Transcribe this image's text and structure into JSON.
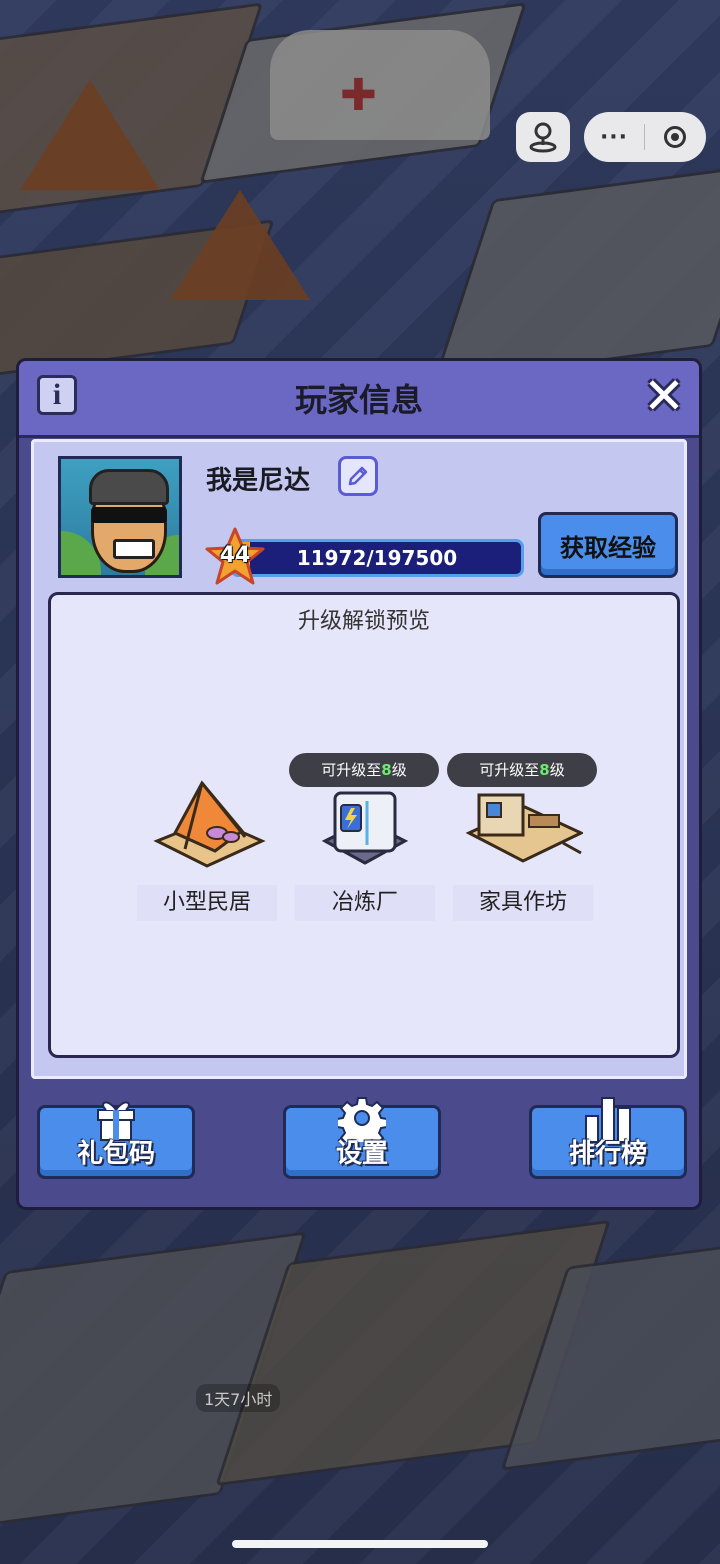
{
  "dialog": {
    "title": "玩家信息",
    "info_label": "i"
  },
  "player": {
    "name": "我是尼达",
    "level": "44",
    "exp_text": "11972/197500",
    "exp_progress": 0.0606
  },
  "buttons": {
    "get_exp": "获取经验",
    "gift_code": "礼包码",
    "settings": "设置",
    "ranking": "排行榜"
  },
  "preview": {
    "title": "升级解锁预览",
    "buildings": [
      {
        "name": "小型民居",
        "badge": null
      },
      {
        "name": "冶炼厂",
        "badge_prefix": "可升级至",
        "badge_level": "8",
        "badge_suffix": "级"
      },
      {
        "name": "家具作坊",
        "badge_prefix": "可升级至",
        "badge_level": "8",
        "badge_suffix": "级"
      }
    ]
  },
  "scene": {
    "timer": "1天7小时"
  },
  "capsule": {
    "more_label": "···"
  },
  "colors": {
    "header": "#6b68c4",
    "panel": "#c4c7f0",
    "button": "#4a8dea",
    "exp_bar": "#1b1f7a",
    "star": "#f3a12f",
    "badge_level": "#6ee86e"
  }
}
